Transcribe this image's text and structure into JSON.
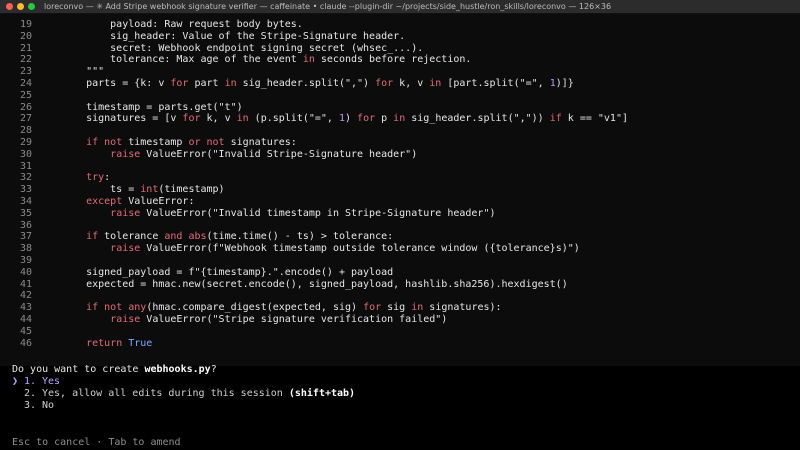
{
  "window": {
    "title": "loreconvo — ✳ Add Stripe webhook signature verifier — caffeinate • claude --plugin-dir ~/projects/side_hustle/ron_skills/loreconvo — 126×36"
  },
  "code_lines": [
    {
      "n": "19",
      "tokens": [
        {
          "t": "        payload: Raw request body bytes.",
          "c": "str"
        }
      ]
    },
    {
      "n": "20",
      "tokens": [
        {
          "t": "        sig_header: Value of the Stripe-Signature header.",
          "c": "str"
        }
      ]
    },
    {
      "n": "21",
      "tokens": [
        {
          "t": "        secret: Webhook endpoint signing secret (whsec_...).",
          "c": "str"
        }
      ]
    },
    {
      "n": "22",
      "tokens": [
        {
          "t": "        tolerance: Max age of the event ",
          "c": "str"
        },
        {
          "t": "in",
          "c": "kw"
        },
        {
          "t": " seconds before rejection.",
          "c": "str"
        }
      ]
    },
    {
      "n": "23",
      "tokens": [
        {
          "t": "    \"\"\"",
          "c": "str"
        }
      ]
    },
    {
      "n": "24",
      "tokens": [
        {
          "t": "    parts = {k: v ",
          "c": ""
        },
        {
          "t": "for",
          "c": "kw"
        },
        {
          "t": " part ",
          "c": ""
        },
        {
          "t": "in",
          "c": "kw"
        },
        {
          "t": " sig_header.split(\",\") ",
          "c": ""
        },
        {
          "t": "for",
          "c": "kw"
        },
        {
          "t": " k, v ",
          "c": ""
        },
        {
          "t": "in",
          "c": "kw"
        },
        {
          "t": " [part.split(\"=\", ",
          "c": ""
        },
        {
          "t": "1",
          "c": "num"
        },
        {
          "t": ")]}",
          "c": ""
        }
      ]
    },
    {
      "n": "25",
      "tokens": [
        {
          "t": "",
          "c": ""
        }
      ]
    },
    {
      "n": "26",
      "tokens": [
        {
          "t": "    timestamp = parts.get(\"t\")",
          "c": ""
        }
      ]
    },
    {
      "n": "27",
      "tokens": [
        {
          "t": "    signatures = [v ",
          "c": ""
        },
        {
          "t": "for",
          "c": "kw"
        },
        {
          "t": " k, v ",
          "c": ""
        },
        {
          "t": "in",
          "c": "kw"
        },
        {
          "t": " (p.split(\"=\", ",
          "c": ""
        },
        {
          "t": "1",
          "c": "num"
        },
        {
          "t": ") ",
          "c": ""
        },
        {
          "t": "for",
          "c": "kw"
        },
        {
          "t": " p ",
          "c": ""
        },
        {
          "t": "in",
          "c": "kw"
        },
        {
          "t": " sig_header.split(\",\")) ",
          "c": ""
        },
        {
          "t": "if",
          "c": "kw"
        },
        {
          "t": " k == \"v1\"]",
          "c": ""
        }
      ]
    },
    {
      "n": "28",
      "tokens": [
        {
          "t": "",
          "c": ""
        }
      ]
    },
    {
      "n": "29",
      "tokens": [
        {
          "t": "    ",
          "c": ""
        },
        {
          "t": "if not",
          "c": "kw"
        },
        {
          "t": " timestamp ",
          "c": ""
        },
        {
          "t": "or not",
          "c": "kw"
        },
        {
          "t": " signatures:",
          "c": ""
        }
      ]
    },
    {
      "n": "30",
      "tokens": [
        {
          "t": "        ",
          "c": ""
        },
        {
          "t": "raise",
          "c": "kw"
        },
        {
          "t": " ValueError(\"Invalid Stripe-Signature header\")",
          "c": ""
        }
      ]
    },
    {
      "n": "31",
      "tokens": [
        {
          "t": "",
          "c": ""
        }
      ]
    },
    {
      "n": "32",
      "tokens": [
        {
          "t": "    ",
          "c": ""
        },
        {
          "t": "try",
          "c": "kw"
        },
        {
          "t": ":",
          "c": ""
        }
      ]
    },
    {
      "n": "33",
      "tokens": [
        {
          "t": "        ts = ",
          "c": ""
        },
        {
          "t": "int",
          "c": "kw"
        },
        {
          "t": "(timestamp)",
          "c": ""
        }
      ]
    },
    {
      "n": "34",
      "tokens": [
        {
          "t": "    ",
          "c": ""
        },
        {
          "t": "except",
          "c": "kw"
        },
        {
          "t": " ValueError:",
          "c": ""
        }
      ]
    },
    {
      "n": "35",
      "tokens": [
        {
          "t": "        ",
          "c": ""
        },
        {
          "t": "raise",
          "c": "kw"
        },
        {
          "t": " ValueError(\"Invalid timestamp in Stripe-Signature header\")",
          "c": ""
        }
      ]
    },
    {
      "n": "36",
      "tokens": [
        {
          "t": "",
          "c": ""
        }
      ]
    },
    {
      "n": "37",
      "tokens": [
        {
          "t": "    ",
          "c": ""
        },
        {
          "t": "if",
          "c": "kw"
        },
        {
          "t": " tolerance ",
          "c": ""
        },
        {
          "t": "and",
          "c": "kw"
        },
        {
          "t": " ",
          "c": ""
        },
        {
          "t": "abs",
          "c": "kw"
        },
        {
          "t": "(time.time() - ts) > tolerance:",
          "c": ""
        }
      ]
    },
    {
      "n": "38",
      "tokens": [
        {
          "t": "        ",
          "c": ""
        },
        {
          "t": "raise",
          "c": "kw"
        },
        {
          "t": " ValueError(f\"Webhook timestamp outside tolerance window ({tolerance}s)\")",
          "c": ""
        }
      ]
    },
    {
      "n": "39",
      "tokens": [
        {
          "t": "",
          "c": ""
        }
      ]
    },
    {
      "n": "40",
      "tokens": [
        {
          "t": "    signed_payload = f\"{timestamp}.\".encode() + payload",
          "c": ""
        }
      ]
    },
    {
      "n": "41",
      "tokens": [
        {
          "t": "    expected = hmac.new(secret.encode(), signed_payload, hashlib.sha256).hexdigest()",
          "c": ""
        }
      ]
    },
    {
      "n": "42",
      "tokens": [
        {
          "t": "",
          "c": ""
        }
      ]
    },
    {
      "n": "43",
      "tokens": [
        {
          "t": "    ",
          "c": ""
        },
        {
          "t": "if not",
          "c": "kw"
        },
        {
          "t": " ",
          "c": ""
        },
        {
          "t": "any",
          "c": "kw"
        },
        {
          "t": "(hmac.compare_digest(expected, sig) ",
          "c": ""
        },
        {
          "t": "for",
          "c": "kw"
        },
        {
          "t": " sig ",
          "c": ""
        },
        {
          "t": "in",
          "c": "kw"
        },
        {
          "t": " signatures):",
          "c": ""
        }
      ]
    },
    {
      "n": "44",
      "tokens": [
        {
          "t": "        ",
          "c": ""
        },
        {
          "t": "raise",
          "c": "kw"
        },
        {
          "t": " ValueError(\"Stripe signature verification failed\")",
          "c": ""
        }
      ]
    },
    {
      "n": "45",
      "tokens": [
        {
          "t": "",
          "c": ""
        }
      ]
    },
    {
      "n": "46",
      "tokens": [
        {
          "t": "    ",
          "c": ""
        },
        {
          "t": "return",
          "c": "kw"
        },
        {
          "t": " ",
          "c": ""
        },
        {
          "t": "True",
          "c": "bool"
        }
      ]
    }
  ],
  "prompt": {
    "question_prefix": "Do you want to create ",
    "question_file": "webhooks.py",
    "question_suffix": "?",
    "options": [
      {
        "marker": "❯",
        "num": "1.",
        "label": "Yes",
        "hint": ""
      },
      {
        "marker": "",
        "num": "2.",
        "label": "Yes, allow all edits during this session ",
        "hint": "(shift+tab)"
      },
      {
        "marker": "",
        "num": "3.",
        "label": "No",
        "hint": ""
      }
    ],
    "footer": "Esc to cancel · Tab to amend"
  },
  "colors": {
    "keyword": "#e06c75",
    "number": "#c792ea",
    "boolean": "#7ea7ff",
    "selected_option": "#b9a8ff"
  }
}
